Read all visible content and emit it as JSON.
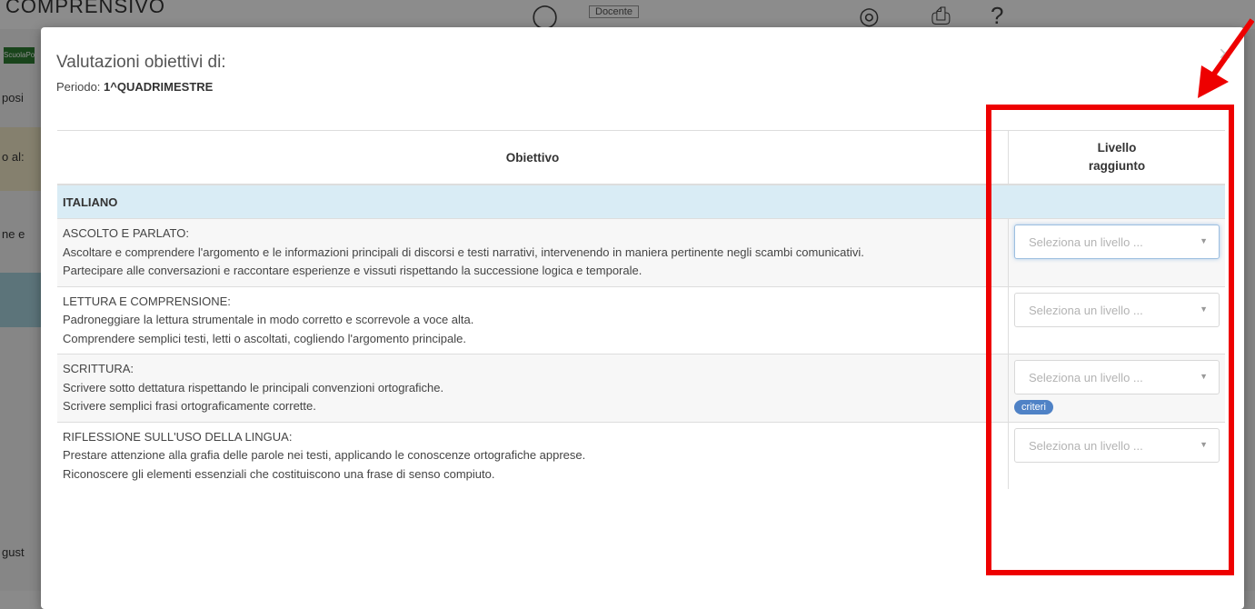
{
  "background": {
    "brand": "COMPRENSIVO",
    "user_chip": "Docente",
    "left_chip": "ScuolaPo",
    "left_labels": [
      "posi",
      "o al:",
      "ne e",
      "gust"
    ]
  },
  "modal": {
    "title": "Valutazioni obiettivi di:",
    "period_label": "Periodo:",
    "period_value": "1^QUADRIMESTRE",
    "close": "×"
  },
  "table": {
    "header_objective": "Obiettivo",
    "header_level_line1": "Livello",
    "header_level_line2": "raggiunto",
    "section": "ITALIANO",
    "rows": [
      {
        "title": "ASCOLTO E PARLATO:",
        "lines": [
          "Ascoltare e comprendere l'argomento e le informazioni principali di discorsi e testi narrativi, intervenendo in maniera pertinente negli scambi comunicativi.",
          "Partecipare alle conversazioni e raccontare esperienze e vissuti rispettando la successione logica e temporale."
        ],
        "select_placeholder": "Seleziona un livello ..."
      },
      {
        "title": "LETTURA E COMPRENSIONE:",
        "lines": [
          "Padroneggiare la lettura strumentale in modo corretto e scorrevole a voce alta.",
          "Comprendere semplici testi, letti o ascoltati, cogliendo l'argomento principale."
        ],
        "select_placeholder": "Seleziona un livello ..."
      },
      {
        "title": "SCRITTURA:",
        "lines": [
          "Scrivere sotto dettatura rispettando le principali convenzioni ortografiche.",
          "Scrivere semplici frasi ortograficamente corrette."
        ],
        "select_placeholder": "Seleziona un livello ...",
        "badge": "criteri"
      },
      {
        "title": "RIFLESSIONE SULL'USO DELLA LINGUA:",
        "lines": [
          "Prestare attenzione alla grafia delle parole nei testi, applicando le conoscenze ortografiche apprese.",
          "Riconoscere gli elementi essenziali che costituiscono una frase di senso compiuto."
        ],
        "select_placeholder": "Seleziona un livello ..."
      }
    ]
  },
  "colors": {
    "annotation": "#ee0000",
    "section_bg": "#d9ecf5",
    "badge": "#4f82c6"
  }
}
